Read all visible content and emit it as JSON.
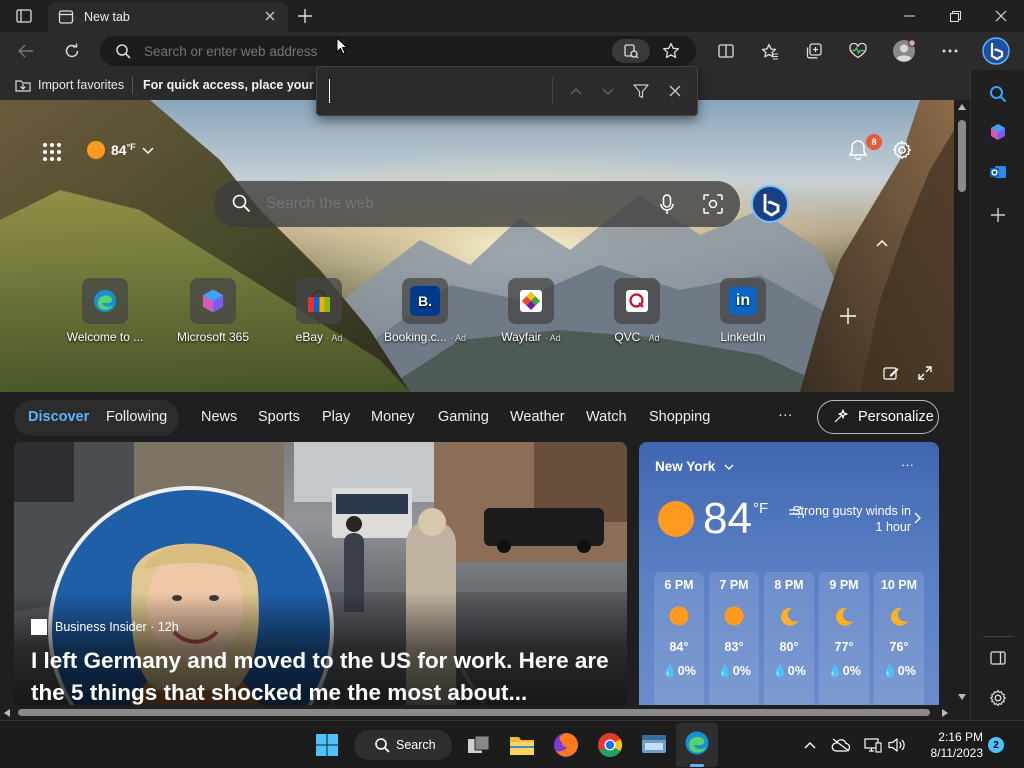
{
  "browser": {
    "tab_title": "New tab",
    "address_placeholder": "Search or enter web address"
  },
  "favorites_bar": {
    "import_label": "Import favorites",
    "hint": "For quick access, place your favo"
  },
  "findbar": {
    "value": ""
  },
  "weather_pill": {
    "temp": "84",
    "unit": "°F"
  },
  "notifications": {
    "count": "8"
  },
  "search": {
    "placeholder": "Search the web"
  },
  "quick_links": [
    {
      "label": "Welcome to ...",
      "ad": "",
      "icon": "edge-icon"
    },
    {
      "label": "Microsoft 365",
      "ad": "",
      "icon": "microsoft365-icon"
    },
    {
      "label": "eBay",
      "ad": "· Ad",
      "icon": "ebay-icon"
    },
    {
      "label": "Booking.c...",
      "ad": "· Ad",
      "icon": "booking-icon"
    },
    {
      "label": "Wayfair",
      "ad": "· Ad",
      "icon": "wayfair-icon"
    },
    {
      "label": "QVC",
      "ad": "· Ad",
      "icon": "qvc-icon"
    },
    {
      "label": "LinkedIn",
      "ad": "",
      "icon": "linkedin-icon"
    }
  ],
  "nav": {
    "discover": "Discover",
    "following": "Following",
    "items": [
      "News",
      "Sports",
      "Play",
      "Money",
      "Gaming",
      "Weather",
      "Watch",
      "Shopping"
    ],
    "more": "···",
    "personalize": "Personalize"
  },
  "article": {
    "source": "Business Insider",
    "age": "· 12h",
    "headline": "I left Germany and moved to the US for work. Here are the 5 things that shocked me the most about..."
  },
  "weather_card": {
    "location": "New York",
    "temp": "84",
    "unit": "°F",
    "alert": "Strong gusty winds in 1 hour",
    "hours": [
      {
        "time": "6 PM",
        "temp": "84°",
        "precip": "0%",
        "icon": "sun-icon"
      },
      {
        "time": "7 PM",
        "temp": "83°",
        "precip": "0%",
        "icon": "sun-icon"
      },
      {
        "time": "8 PM",
        "temp": "80°",
        "precip": "0%",
        "icon": "moon-icon"
      },
      {
        "time": "9 PM",
        "temp": "77°",
        "precip": "0%",
        "icon": "moon-icon"
      },
      {
        "time": "10 PM",
        "temp": "76°",
        "precip": "0%",
        "icon": "moon-icon"
      }
    ]
  },
  "taskbar": {
    "search_label": "Search",
    "time": "2:16 PM",
    "date": "8/11/2023",
    "notification_count": "2"
  },
  "colors": {
    "accent": "#5fb2ff",
    "weather_blue": "#4a71bb",
    "sun": "#ff9a1f"
  }
}
